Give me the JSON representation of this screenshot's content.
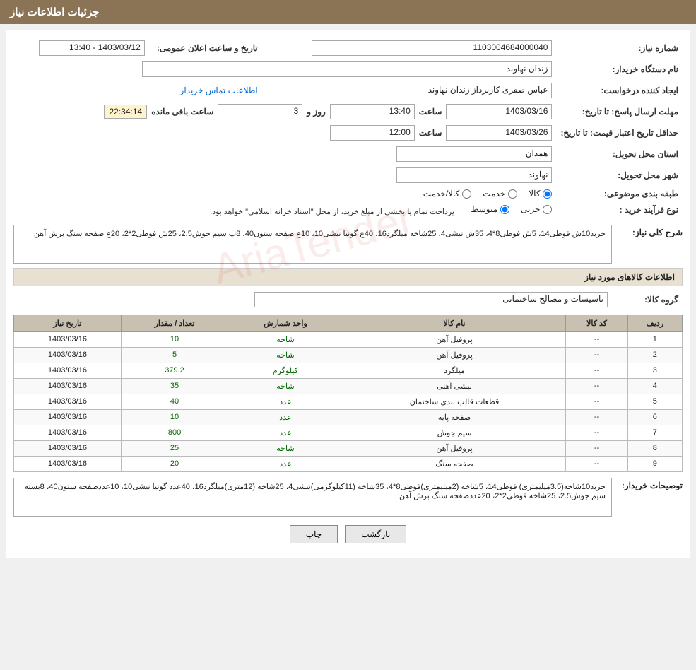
{
  "header": {
    "title": "جزئیات اطلاعات نیاز"
  },
  "fields": {
    "need_number_label": "شماره نیاز:",
    "need_number_value": "1103004684000040",
    "buyer_org_label": "نام دستگاه خریدار:",
    "buyer_org_value": "زندان نهاوند",
    "requester_label": "ایجاد کننده درخواست:",
    "requester_value": "عباس صفری کاربرداز زندان نهاوند",
    "contact_info_link": "اطلاعات تماس خریدار",
    "response_deadline_label": "مهلت ارسال پاسخ: تا تاریخ:",
    "response_date": "1403/03/16",
    "response_time_label": "ساعت",
    "response_time": "13:40",
    "response_day_label": "روز و",
    "response_days": "3",
    "response_remaining_label": "ساعت باقی مانده",
    "response_remaining": "22:34:14",
    "price_validity_label": "حداقل تاریخ اعتبار قیمت: تا تاریخ:",
    "price_validity_date": "1403/03/26",
    "price_validity_time_label": "ساعت",
    "price_validity_time": "12:00",
    "delivery_province_label": "استان محل تحویل:",
    "delivery_province_value": "همدان",
    "delivery_city_label": "شهر محل تحویل:",
    "delivery_city_value": "نهاوند",
    "category_label": "طبقه بندی موضوعی:",
    "category_options": [
      "کالا",
      "خدمت",
      "کالا/خدمت"
    ],
    "category_selected": "کالا",
    "procurement_type_label": "نوع فرآیند خرید :",
    "procurement_options": [
      "جزیی",
      "متوسط"
    ],
    "procurement_selected": "متوسط",
    "procurement_note": "پرداخت تمام یا بخشی از مبلغ خرید، از محل \"اسناد خزانه اسلامی\" خواهد بود.",
    "announcement_datetime_label": "تاریخ و ساعت اعلان عمومی:",
    "announcement_datetime_value": "1403/03/12 - 13:40"
  },
  "general_desc": {
    "section_label": "شرح کلی نیاز:",
    "content": "خرید10ش فوطی14، 5ش فوطی8*4، 35ش نبشی4، 25شاخه میلگرد16، 40ع گونیا نبشی10، 10ع صفحه ستون40، 8پ سیم جوش2.5، 25ش فوطی2*2، 20ع صفحه سنگ برش آهن"
  },
  "products_section": {
    "title": "اطلاعات کالاهای مورد نیاز",
    "product_group_label": "گروه کالا:",
    "product_group_value": "تاسیسات و مصالح ساختمانی",
    "columns": {
      "row": "ردیف",
      "product_code": "کد کالا",
      "product_name": "نام کالا",
      "unit_code": "واحد شمارش",
      "quantity": "تعداد / مقدار",
      "need_date": "تاریخ نیاز"
    },
    "rows": [
      {
        "row": "1",
        "code": "--",
        "name": "پروفیل آهن",
        "unit": "شاخه",
        "quantity": "10",
        "date": "1403/03/16"
      },
      {
        "row": "2",
        "code": "--",
        "name": "پروفیل آهن",
        "unit": "شاخه",
        "quantity": "5",
        "date": "1403/03/16"
      },
      {
        "row": "3",
        "code": "--",
        "name": "میلگرد",
        "unit": "کیلوگرم",
        "quantity": "379.2",
        "date": "1403/03/16"
      },
      {
        "row": "4",
        "code": "--",
        "name": "نبشی آهنی",
        "unit": "شاخه",
        "quantity": "35",
        "date": "1403/03/16"
      },
      {
        "row": "5",
        "code": "--",
        "name": "قطعات قالب بندی ساختمان",
        "unit": "عدد",
        "quantity": "40",
        "date": "1403/03/16"
      },
      {
        "row": "6",
        "code": "--",
        "name": "صفحه پایه",
        "unit": "عدد",
        "quantity": "10",
        "date": "1403/03/16"
      },
      {
        "row": "7",
        "code": "--",
        "name": "سیم جوش",
        "unit": "عدد",
        "quantity": "800",
        "date": "1403/03/16"
      },
      {
        "row": "8",
        "code": "--",
        "name": "پروفیل آهن",
        "unit": "شاخه",
        "quantity": "25",
        "date": "1403/03/16"
      },
      {
        "row": "9",
        "code": "--",
        "name": "صفحه سنگ",
        "unit": "عدد",
        "quantity": "20",
        "date": "1403/03/16"
      }
    ]
  },
  "buyer_notes": {
    "label": "توصیحات خریدار:",
    "content": "خرید10شاخه(3.5میلیمتری) فوطی14، 5شاخه (2میلیمتری)فوطی8*4، 35شاخه (11کیلوگرمی)نبشی4، 25شاخه (12متری)میلگرد16، 40عدد گونیا نبشی10، 10عددصفحه ستون40، 8بسته سیم جوش2.5، 25شاخه فوطی2*2، 20عددصفحه سنگ برش آهن"
  },
  "buttons": {
    "print": "چاپ",
    "back": "بازگشت"
  }
}
